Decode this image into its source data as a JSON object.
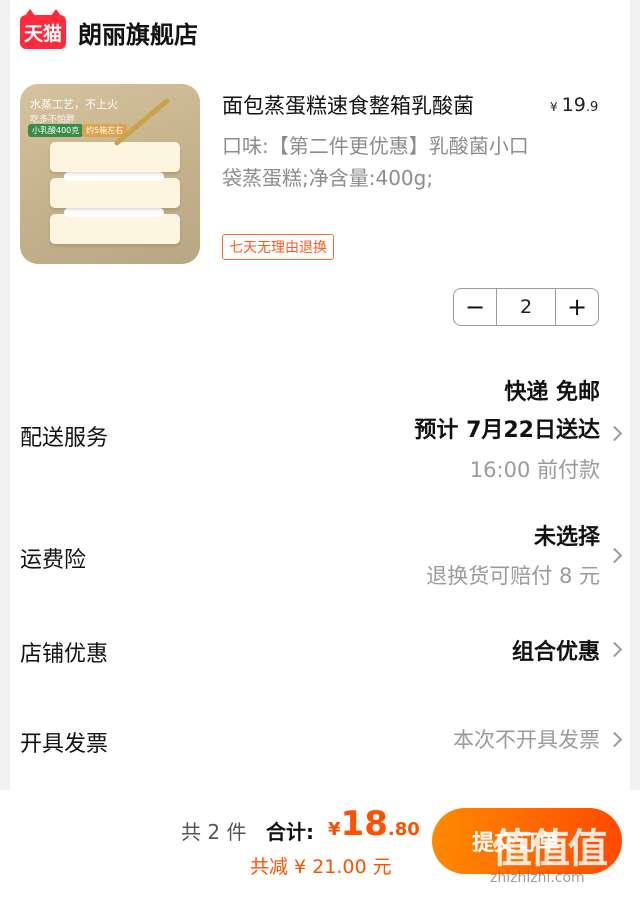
{
  "store": {
    "badge": "天猫",
    "name": "朗丽旗舰店"
  },
  "product": {
    "title": "面包蒸蛋糕速食整箱乳酸菌",
    "price_symbol": "¥",
    "price_int": "19",
    "price_dec": ".9",
    "spec": "口味:【第二件更优惠】乳酸菌小口袋蒸蛋糕;净含量:400g;",
    "return_tag": "七天无理由退换",
    "image_text": [
      "水蒸工艺，不上火",
      "吃多不怕胖",
      "小乳酸400克",
      "约5箱左右"
    ]
  },
  "quantity": {
    "minus": "−",
    "value": "2",
    "plus": "+"
  },
  "rows": {
    "delivery": {
      "label": "配送服务",
      "line1": "快递 免邮",
      "line2": "预计 7月22日送达",
      "line3": "16:00 前付款"
    },
    "freight_insurance": {
      "label": "运费险",
      "line1": "未选择",
      "line2": "退换货可赔付 8 元"
    },
    "store_discount": {
      "label": "店铺优惠",
      "value": "组合优惠"
    },
    "invoice": {
      "label": "开具发票",
      "value": "本次不开具发票"
    }
  },
  "summary": {
    "count": "共 2 件",
    "total_label": "合计:",
    "total_symbol": "¥",
    "total_int": "18",
    "total_dec": ".80",
    "discount": "共减 ¥ 21.00 元",
    "submit": "提交订单"
  },
  "watermark": {
    "main": "值值值",
    "sub": "zhizhizhi.com"
  },
  "colors": {
    "accent": "#ff5000",
    "tmall_red": "#ff2a3c",
    "return_tag": "#ff5a1f"
  }
}
